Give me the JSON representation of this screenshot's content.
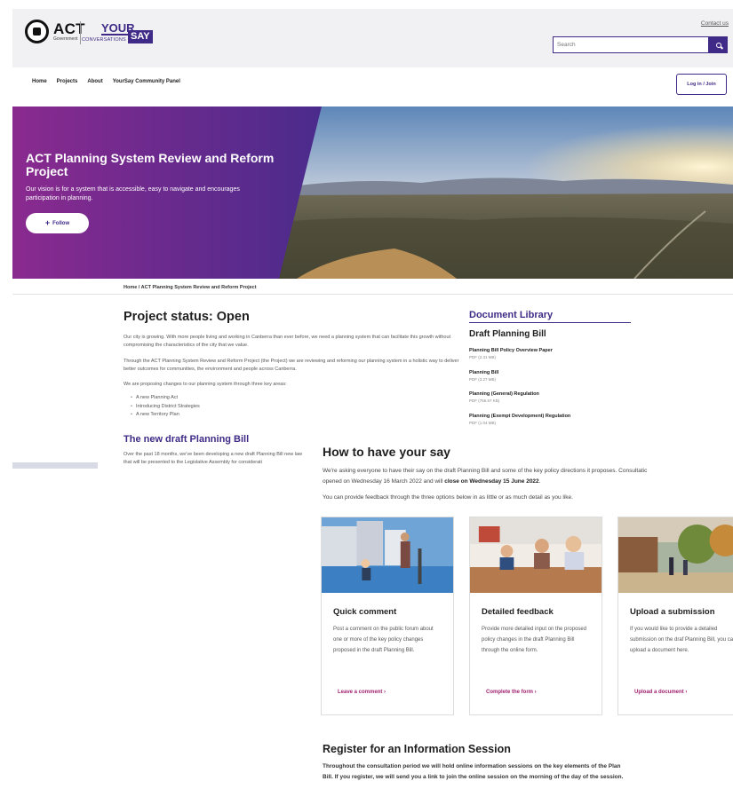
{
  "header": {
    "logo_act": "ACT",
    "logo_act_sub": "Government",
    "logo_your": "YOUR",
    "logo_conversations": "CONVERSATIONS",
    "logo_say": "SAY",
    "contact_label": "Contact us",
    "search_placeholder": "Search"
  },
  "nav": {
    "items": [
      "Home",
      "Projects",
      "About",
      "YourSay Community Panel"
    ],
    "login_label": "Log in / Join"
  },
  "hero": {
    "title": "ACT Planning System Review and Reform Project",
    "subtitle": "Our vision is for a system that is accessible, easy to navigate and encourages participation in planning.",
    "follow_label": "Follow",
    "colors": {
      "gradient_start": "#8a2a8f",
      "gradient_end": "#4a2b8c"
    }
  },
  "breadcrumb": "Home / ACT Planning System Review and Reform Project",
  "project_status": {
    "title": "Project status: Open",
    "p1": "Our city is growing. With more people living and working in Canberra than ever before, we need a planning system that can facilitate this growth without compromising the characteristics of the city that we value.",
    "p2": "Through the ACT Planning System Review and Reform Project (the Project) we are reviewing and reforming our planning system in a holistic way to deliver better outcomes for communities, the environment and people across Canberra.",
    "p3": "We are proposing changes to our planning system through three key areas:",
    "list": [
      "A new Planning Act",
      "Introducing District Strategies",
      "A new Territory Plan"
    ]
  },
  "new_bill": {
    "title": "The new draft Planning Bill",
    "text": "Over the past 18 months, we've been developing a new draft Planning Bill new law that will be presented to the Legislative Assembly for considerati"
  },
  "document_library": {
    "title": "Document Library",
    "subtitle": "Draft Planning Bill",
    "docs": [
      {
        "title": "Planning Bill Policy Overview Paper",
        "meta": "PDF (2.31 MB)"
      },
      {
        "title": "Planning Bill",
        "meta": "PDF (3.27 MB)"
      },
      {
        "title": "Planning (General) Regulation",
        "meta": "PDF (756.67 KB)"
      },
      {
        "title": "Planning (Exempt Development) Regulation",
        "meta": "PDF (1.04 MB)"
      }
    ]
  },
  "have_your_say": {
    "title": "How to have your say",
    "p1_a": "We're asking everyone to have their say on the draft Planning Bill and some of the key policy directions it proposes. Consultatic",
    "p1_b": "opened on Wednesday 16 March 2022 and will ",
    "p1_bold": "close on Wednesday 15 June 2022",
    "p1_end": ".",
    "p2": "You can provide feedback through the three options below in as little or as much detail as you like."
  },
  "cards": [
    {
      "title": "Quick comment",
      "desc": "Post a comment on the public forum about one or more of the key policy changes proposed in the draft Planning Bill.",
      "link": "Leave a comment ›"
    },
    {
      "title": "Detailed feedback",
      "desc": "Provide more detailed input on the proposed policy changes in the draft Planning Bill through the online form.",
      "link": "Complete the form ›"
    },
    {
      "title": "Upload a submission",
      "desc": "If you would like to provide a detailed submission on the draf Planning Bill, you can upload a document here.",
      "link": "Upload a document ›"
    }
  ],
  "register": {
    "title": "Register for an Information Session",
    "p1": "Throughout the consultation period we will hold online information sessions on the key elements of the Plan",
    "p2": "Bill. If you register, we will send you a link to join the online session on the morning of the day of the session."
  },
  "theme": {
    "brand": "#3f2b87",
    "link": "#a0216e"
  }
}
